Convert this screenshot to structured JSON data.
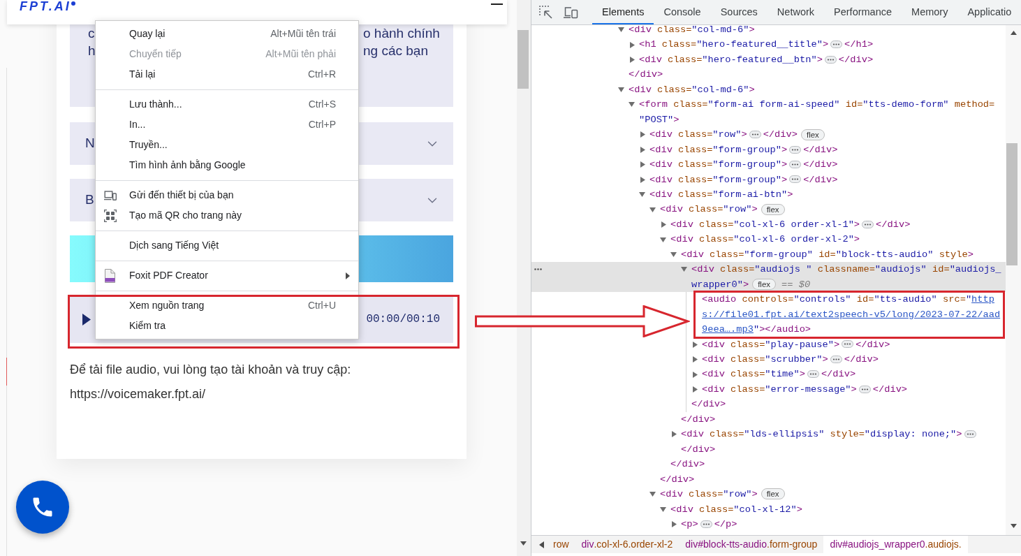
{
  "page": {
    "logo": "FPT.AI",
    "intro_lines": [
      {
        "left": "c",
        "right": "o hành chính"
      },
      {
        "left": "h",
        "right": "ng các bạn"
      }
    ],
    "accordions": [
      {
        "title": "N",
        "expanded": false
      },
      {
        "title": "B",
        "expanded": false
      }
    ],
    "audio_player": {
      "time": "00:00/00:10"
    },
    "download_note": "Để tải file audio, vui lòng tạo tài khoản và truy cập:",
    "download_url": "https://voicemaker.fpt.ai/"
  },
  "context_menu": {
    "sections": [
      {
        "items": [
          {
            "label": "Quay lại",
            "shortcut": "Alt+Mũi tên trái",
            "kind": "plain",
            "disabled": false,
            "submenu": false
          },
          {
            "label": "Chuyển tiếp",
            "shortcut": "Alt+Mũi tên phải",
            "kind": "plain",
            "disabled": true,
            "submenu": false
          },
          {
            "label": "Tải lại",
            "shortcut": "Ctrl+R",
            "kind": "plain",
            "disabled": false,
            "submenu": false
          }
        ]
      },
      {
        "items": [
          {
            "label": "Lưu thành...",
            "shortcut": "Ctrl+S",
            "kind": "plain",
            "disabled": false,
            "submenu": false
          },
          {
            "label": "In...",
            "shortcut": "Ctrl+P",
            "kind": "plain",
            "disabled": false,
            "submenu": false
          },
          {
            "label": "Truyền...",
            "kind": "plain",
            "disabled": false,
            "submenu": false
          },
          {
            "label": "Tìm hình ảnh bằng Google",
            "kind": "plain",
            "disabled": false,
            "submenu": false
          }
        ]
      },
      {
        "items": [
          {
            "label": "Gửi đến thiết bị của bạn",
            "kind": "send-to-device",
            "disabled": false,
            "submenu": false
          },
          {
            "label": "Tạo mã QR cho trang này",
            "kind": "qr-code",
            "disabled": false,
            "submenu": false
          }
        ]
      },
      {
        "items": [
          {
            "label": "Dịch sang Tiếng Việt",
            "kind": "plain",
            "disabled": false,
            "submenu": false
          }
        ]
      },
      {
        "items": [
          {
            "label": "Foxit PDF Creator",
            "kind": "extension",
            "disabled": false,
            "submenu": true
          }
        ]
      },
      {
        "items": [
          {
            "label": "Xem nguồn trang",
            "shortcut": "Ctrl+U",
            "kind": "plain",
            "disabled": false,
            "submenu": false
          },
          {
            "label": "Kiểm tra",
            "kind": "plain",
            "disabled": false,
            "submenu": false
          }
        ]
      }
    ]
  },
  "devtools": {
    "tabs": [
      {
        "label": "Elements",
        "selected": true
      },
      {
        "label": "Console",
        "selected": false
      },
      {
        "label": "Sources",
        "selected": false
      },
      {
        "label": "Network",
        "selected": false
      },
      {
        "label": "Performance",
        "selected": false
      },
      {
        "label": "Memory",
        "selected": false
      },
      {
        "label": "Applicatio",
        "selected": false
      }
    ],
    "tree": [
      {
        "kind": "element",
        "expanded": true,
        "selected": false,
        "open": [
          [
            {
              "tag": "<div"
            },
            {
              "attr": " class=",
              "value": "\"col-md-6\""
            },
            {
              "tag": ">"
            }
          ]
        ],
        "children": [
          {
            "kind": "element",
            "expanded": false,
            "selected": false,
            "open": [
              [
                {
                  "tag": "<h1"
                },
                {
                  "attr": " class=",
                  "value": "\"hero-featured__title\""
                },
                {
                  "tag": ">"
                }
              ]
            ],
            "close": "</h1>"
          },
          {
            "kind": "element",
            "expanded": false,
            "selected": false,
            "open": [
              [
                {
                  "tag": "<div"
                },
                {
                  "attr": " class=",
                  "value": "\"hero-featured__btn\""
                },
                {
                  "tag": ">"
                }
              ]
            ],
            "close": "</div>"
          }
        ],
        "close": "</div>"
      },
      {
        "kind": "element",
        "expanded": true,
        "selected": false,
        "open": [
          [
            {
              "tag": "<div"
            },
            {
              "attr": " class=",
              "value": "\"col-md-6\""
            },
            {
              "tag": ">"
            }
          ]
        ],
        "children": [
          {
            "kind": "element",
            "expanded": true,
            "selected": false,
            "open": [
              [
                {
                  "tag": "<form"
                },
                {
                  "attr": " class=",
                  "value": "\"form-ai form-ai-speed\""
                },
                {
                  "attr": " id=",
                  "value": "\"tts-demo-form\""
                },
                {
                  "attr": " method="
                }
              ],
              [
                {
                  "value": "\"POST\""
                },
                {
                  "tag": ">"
                }
              ]
            ],
            "children": [
              {
                "kind": "element",
                "expanded": false,
                "selected": false,
                "open": [
                  [
                    {
                      "tag": "<div"
                    },
                    {
                      "attr": " class=",
                      "value": "\"row\""
                    },
                    {
                      "tag": ">"
                    }
                  ]
                ],
                "close": "</div>",
                "badge": "flex"
              },
              {
                "kind": "element",
                "expanded": false,
                "selected": false,
                "open": [
                  [
                    {
                      "tag": "<div"
                    },
                    {
                      "attr": " class=",
                      "value": "\"form-group\""
                    },
                    {
                      "tag": ">"
                    }
                  ]
                ],
                "close": "</div>"
              },
              {
                "kind": "element",
                "expanded": false,
                "selected": false,
                "open": [
                  [
                    {
                      "tag": "<div"
                    },
                    {
                      "attr": " class=",
                      "value": "\"form-group\""
                    },
                    {
                      "tag": ">"
                    }
                  ]
                ],
                "close": "</div>"
              },
              {
                "kind": "element",
                "expanded": false,
                "selected": false,
                "open": [
                  [
                    {
                      "tag": "<div"
                    },
                    {
                      "attr": " class=",
                      "value": "\"form-group\""
                    },
                    {
                      "tag": ">"
                    }
                  ]
                ],
                "close": "</div>"
              },
              {
                "kind": "element",
                "expanded": true,
                "selected": false,
                "open": [
                  [
                    {
                      "tag": "<div"
                    },
                    {
                      "attr": " class=",
                      "value": "\"form-ai-btn\""
                    },
                    {
                      "tag": ">"
                    }
                  ]
                ],
                "children": [
                  {
                    "kind": "element",
                    "expanded": true,
                    "selected": false,
                    "badge": "flex",
                    "open": [
                      [
                        {
                          "tag": "<div"
                        },
                        {
                          "attr": " class=",
                          "value": "\"row\""
                        },
                        {
                          "tag": ">"
                        }
                      ]
                    ],
                    "children": [
                      {
                        "kind": "element",
                        "expanded": false,
                        "selected": false,
                        "open": [
                          [
                            {
                              "tag": "<div"
                            },
                            {
                              "attr": " class=",
                              "value": "\"col-xl-6 order-xl-1\""
                            },
                            {
                              "tag": ">"
                            }
                          ]
                        ],
                        "close": "</div>"
                      },
                      {
                        "kind": "element",
                        "expanded": true,
                        "selected": false,
                        "open": [
                          [
                            {
                              "tag": "<div"
                            },
                            {
                              "attr": " class=",
                              "value": "\"col-xl-6 order-xl-2\""
                            },
                            {
                              "tag": ">"
                            }
                          ]
                        ],
                        "children": [
                          {
                            "kind": "element",
                            "expanded": true,
                            "selected": false,
                            "open": [
                              [
                                {
                                  "tag": "<div"
                                },
                                {
                                  "attr": " class=",
                                  "value": "\"form-group\""
                                },
                                {
                                  "attr": " id=",
                                  "value": "\"block-tts-audio\""
                                },
                                {
                                  "attr": " style"
                                },
                                {
                                  "tag": ">"
                                }
                              ]
                            ],
                            "children": [
                              {
                                "kind": "element",
                                "expanded": true,
                                "selected": true,
                                "badge": "flex",
                                "note": "== $0",
                                "open": [
                                  [
                                    {
                                      "tag": "<div"
                                    },
                                    {
                                      "attr": " class=",
                                      "value": "\"audiojs \""
                                    },
                                    {
                                      "attr": " classname=",
                                      "value": "\"audiojs\""
                                    },
                                    {
                                      "attr": " id=",
                                      "value": "\"audiojs_"
                                    }
                                  ],
                                  [
                                    {
                                      "value": "wrapper0\""
                                    },
                                    {
                                      "tag": ">"
                                    }
                                  ]
                                ],
                                "children": [
                                  {
                                    "kind": "leaf",
                                    "selected": false,
                                    "open": [
                                      [
                                        {
                                          "tag": "<audio"
                                        },
                                        {
                                          "attr": " controls=",
                                          "value": "\"controls\""
                                        },
                                        {
                                          "attr": " id=",
                                          "value": "\"tts-audio\""
                                        },
                                        {
                                          "attr": " src=",
                                          "value": "\""
                                        },
                                        {
                                          "link": "http"
                                        }
                                      ],
                                      [
                                        {
                                          "link": "s://file01.fpt.ai/text2speech-v5/long/2023-07-22/aad"
                                        }
                                      ],
                                      [
                                        {
                                          "link": "9eea….mp3"
                                        },
                                        {
                                          "value": "\""
                                        },
                                        {
                                          "tag": "></audio>"
                                        }
                                      ]
                                    ]
                                  },
                                  {
                                    "kind": "element",
                                    "expanded": false,
                                    "selected": false,
                                    "open": [
                                      [
                                        {
                                          "tag": "<div"
                                        },
                                        {
                                          "attr": " class=",
                                          "value": "\"play-pause\""
                                        },
                                        {
                                          "tag": ">"
                                        }
                                      ]
                                    ],
                                    "close": "</div>"
                                  },
                                  {
                                    "kind": "element",
                                    "expanded": false,
                                    "selected": false,
                                    "open": [
                                      [
                                        {
                                          "tag": "<div"
                                        },
                                        {
                                          "attr": " class=",
                                          "value": "\"scrubber\""
                                        },
                                        {
                                          "tag": ">"
                                        }
                                      ]
                                    ],
                                    "close": "</div>"
                                  },
                                  {
                                    "kind": "element",
                                    "expanded": false,
                                    "selected": false,
                                    "open": [
                                      [
                                        {
                                          "tag": "<div"
                                        },
                                        {
                                          "attr": " class=",
                                          "value": "\"time\""
                                        },
                                        {
                                          "tag": ">"
                                        }
                                      ]
                                    ],
                                    "close": "</div>"
                                  },
                                  {
                                    "kind": "element",
                                    "expanded": false,
                                    "selected": false,
                                    "open": [
                                      [
                                        {
                                          "tag": "<div"
                                        },
                                        {
                                          "attr": " class=",
                                          "value": "\"error-message\""
                                        },
                                        {
                                          "tag": ">"
                                        }
                                      ]
                                    ],
                                    "close": "</div>"
                                  }
                                ],
                                "close": "</div>"
                              }
                            ],
                            "close": "</div>"
                          },
                          {
                            "kind": "element",
                            "expanded": false,
                            "selected": false,
                            "open": [
                              [
                                {
                                  "tag": "<div"
                                },
                                {
                                  "attr": " class=",
                                  "value": "\"lds-ellipsis\""
                                },
                                {
                                  "attr": " style=",
                                  "value": "\"display: none;\""
                                },
                                {
                                  "tag": ">"
                                }
                              ]
                            ],
                            "close": "</div>"
                          }
                        ],
                        "close": "</div>"
                      }
                    ],
                    "close": "</div>"
                  },
                  {
                    "kind": "element",
                    "expanded": true,
                    "selected": false,
                    "badge": "flex",
                    "open": [
                      [
                        {
                          "tag": "<div"
                        },
                        {
                          "attr": " class=",
                          "value": "\"row\""
                        },
                        {
                          "tag": ">"
                        }
                      ]
                    ],
                    "children": [
                      {
                        "kind": "element",
                        "expanded": true,
                        "selected": false,
                        "open": [
                          [
                            {
                              "tag": "<div"
                            },
                            {
                              "attr": " class=",
                              "value": "\"col-xl-12\""
                            },
                            {
                              "tag": ">"
                            }
                          ]
                        ],
                        "children": [
                          {
                            "kind": "element",
                            "expanded": false,
                            "selected": false,
                            "open": [
                              [
                                {
                                  "tag": "<p>"
                                }
                              ]
                            ],
                            "close": "</p>"
                          }
                        ]
                      }
                    ]
                  }
                ]
              }
            ]
          }
        ]
      }
    ],
    "breadcrumbs": [
      {
        "classes": "row",
        "selected": false
      },
      {
        "tag": "div",
        "classes": ".col-xl-6.order-xl-2",
        "selected": false
      },
      {
        "tag": "div",
        "id": "#block-tts-audio",
        "classes": ".form-group",
        "selected": false
      },
      {
        "tag": "div",
        "id": "#audiojs_wrapper0",
        "classes": ".audiojs.",
        "selected": true
      }
    ]
  }
}
